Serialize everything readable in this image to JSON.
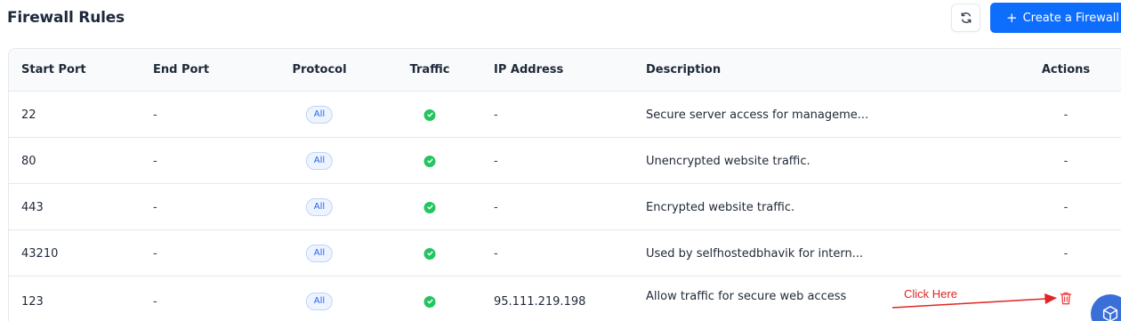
{
  "header": {
    "title": "Firewall Rules",
    "create_label": "Create a Firewall",
    "create_plus": "+",
    "refresh_icon": "refresh-icon"
  },
  "table": {
    "columns": [
      "Start Port",
      "End Port",
      "Protocol",
      "Traffic",
      "IP Address",
      "Description",
      "Actions"
    ],
    "rows": [
      {
        "start_port": "22",
        "end_port": "-",
        "protocol": "All",
        "traffic": "allowed",
        "ip": "-",
        "description": "Secure server access for manageme...",
        "actions": "-"
      },
      {
        "start_port": "80",
        "end_port": "-",
        "protocol": "All",
        "traffic": "allowed",
        "ip": "-",
        "description": "Unencrypted website traffic.",
        "actions": "-"
      },
      {
        "start_port": "443",
        "end_port": "-",
        "protocol": "All",
        "traffic": "allowed",
        "ip": "-",
        "description": "Encrypted website traffic.",
        "actions": "-"
      },
      {
        "start_port": "43210",
        "end_port": "-",
        "protocol": "All",
        "traffic": "allowed",
        "ip": "-",
        "description": "Used by selfhostedbhavik for intern...",
        "actions": "-"
      },
      {
        "start_port": "123",
        "end_port": "-",
        "protocol": "All",
        "traffic": "allowed",
        "ip": "95.111.219.198",
        "description": "Allow traffic for secure web access",
        "actions": "delete"
      }
    ]
  },
  "annotation": {
    "text": "Click Here",
    "color": "#e02424"
  },
  "colors": {
    "primary": "#0d6efd",
    "success": "#22c55e",
    "danger": "#ef4444"
  }
}
